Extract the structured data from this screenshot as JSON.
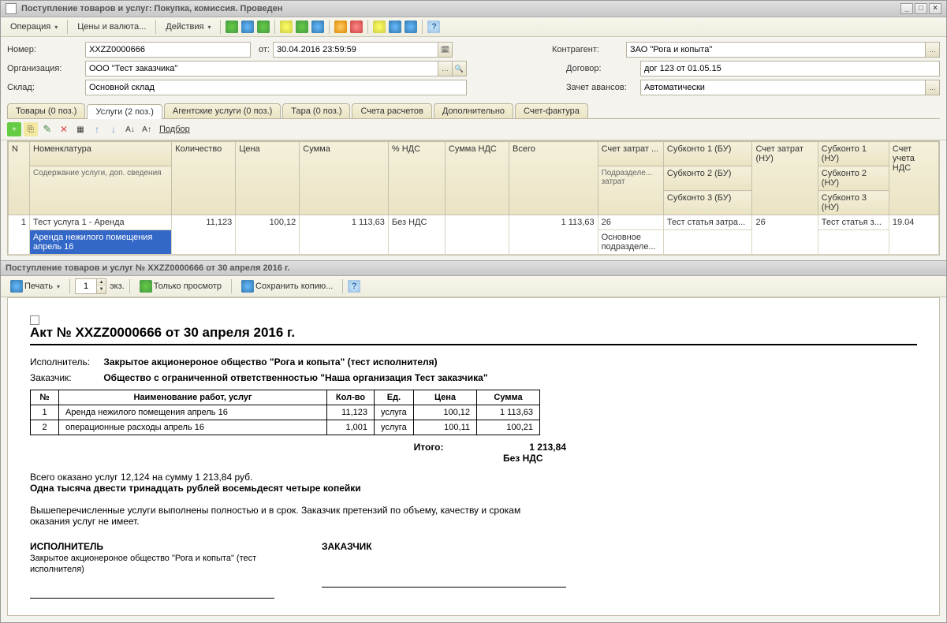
{
  "window": {
    "title": "Поступление товаров и услуг: Покупка, комиссия. Проведен"
  },
  "toolbar": {
    "operation": "Операция",
    "prices": "Цены и валюта...",
    "actions": "Действия",
    "help": "?"
  },
  "form": {
    "number_label": "Номер:",
    "number": "XXZZ0000666",
    "from_label": "от:",
    "date": "30.04.2016 23:59:59",
    "org_label": "Организация:",
    "org": "ООО \"Тест заказчика\"",
    "warehouse_label": "Склад:",
    "warehouse": "Основной склад",
    "counterparty_label": "Контрагент:",
    "counterparty": "ЗАО \"Рога и копыта\"",
    "contract_label": "Договор:",
    "contract": "дог 123 от 01.05.15",
    "advance_label": "Зачет авансов:",
    "advance": "Автоматически"
  },
  "tabs": {
    "goods": "Товары (0 поз.)",
    "services": "Услуги (2 поз.)",
    "agent": "Агентские услуги (0 поз.)",
    "packaging": "Тара (0 поз.)",
    "accounts": "Счета расчетов",
    "extra": "Дополнительно",
    "invoice": "Счет-фактура"
  },
  "gridtb": {
    "select": "Подбор"
  },
  "gridhead": {
    "n": "N",
    "nomen": "Номенклатура",
    "nomen_sub": "Содержание услуги, доп. сведения",
    "qty": "Количество",
    "price": "Цена",
    "sum": "Сумма",
    "vatpct": "% НДС",
    "vatsum": "Сумма НДС",
    "total": "Всего",
    "costacc": "Счет затрат ...",
    "division": "Подразделе... затрат",
    "sub1": "Субконто 1 (БУ)",
    "sub2": "Субконто 2 (БУ)",
    "sub3": "Субконто 3 (БУ)",
    "costacc_nu": "Счет затрат (НУ)",
    "sub1n": "Субконто 1 (НУ)",
    "sub2n": "Субконто 2 (НУ)",
    "sub3n": "Субконто 3 (НУ)",
    "vatacc": "Счет учета НДС"
  },
  "gridrow": {
    "n": "1",
    "nomen": "Тест услуга 1 - Аренда",
    "nomen_sub": "Аренда нежилого помещения апрель 16",
    "qty": "11,123",
    "price": "100,12",
    "sum": "1 113,63",
    "vatpct": "Без НДС",
    "vatsum": "",
    "total": "1 113,63",
    "costacc": "26",
    "division": "Основное подразделе...",
    "sub1": "Тест статья затра...",
    "costacc_nu": "26",
    "sub1n": "Тест статья з...",
    "vatacc": "19.04"
  },
  "subwin": {
    "title": "Поступление товаров и услуг № XXZZ0000666 от 30 апреля 2016 г."
  },
  "printtb": {
    "print": "Печать",
    "copies": "1",
    "copies_label": "экз.",
    "viewonly": "Только просмотр",
    "savecopy": "Сохранить копию..."
  },
  "act": {
    "title": "Акт № XXZZ0000666 от 30 апреля 2016 г.",
    "executor_label": "Исполнитель:",
    "executor": "Закрытое акционероное общество \"Рога и копыта\" (тест исполнителя)",
    "customer_label": "Заказчик:",
    "customer": "Общество с ограниченной ответственностью \"Наша организация Тест заказчика\"",
    "col_n": "№",
    "col_name": "Наименование работ, услуг",
    "col_qty": "Кол-во",
    "col_unit": "Ед.",
    "col_price": "Цена",
    "col_sum": "Сумма",
    "rows": [
      {
        "n": "1",
        "name": "Аренда нежилого помещения апрель 16",
        "qty": "11,123",
        "unit": "услуга",
        "price": "100,12",
        "sum": "1 113,63"
      },
      {
        "n": "2",
        "name": "операционные расходы  апрель 16",
        "qty": "1,001",
        "unit": "услуга",
        "price": "100,11",
        "sum": "100,21"
      }
    ],
    "total_label": "Итого:",
    "total": "1 213,84",
    "novat": "Без НДС",
    "summary": "Всего оказано услуг 12,124 на сумму 1 213,84 руб.",
    "summary_words": "Одна тысяча двести тринадцать рублей восемьдесят четыре копейки",
    "disclaimer": "Вышеперечисленные услуги выполнены полностью и в срок. Заказчик претензий по объему, качеству и срокам оказания услуг не имеет.",
    "sign_exec": "ИСПОЛНИТЕЛЬ",
    "sign_exec_sub": "Закрытое акционероное общество \"Рога и копыта\" (тест исполнителя)",
    "sign_cust": "ЗАКАЗЧИК"
  }
}
